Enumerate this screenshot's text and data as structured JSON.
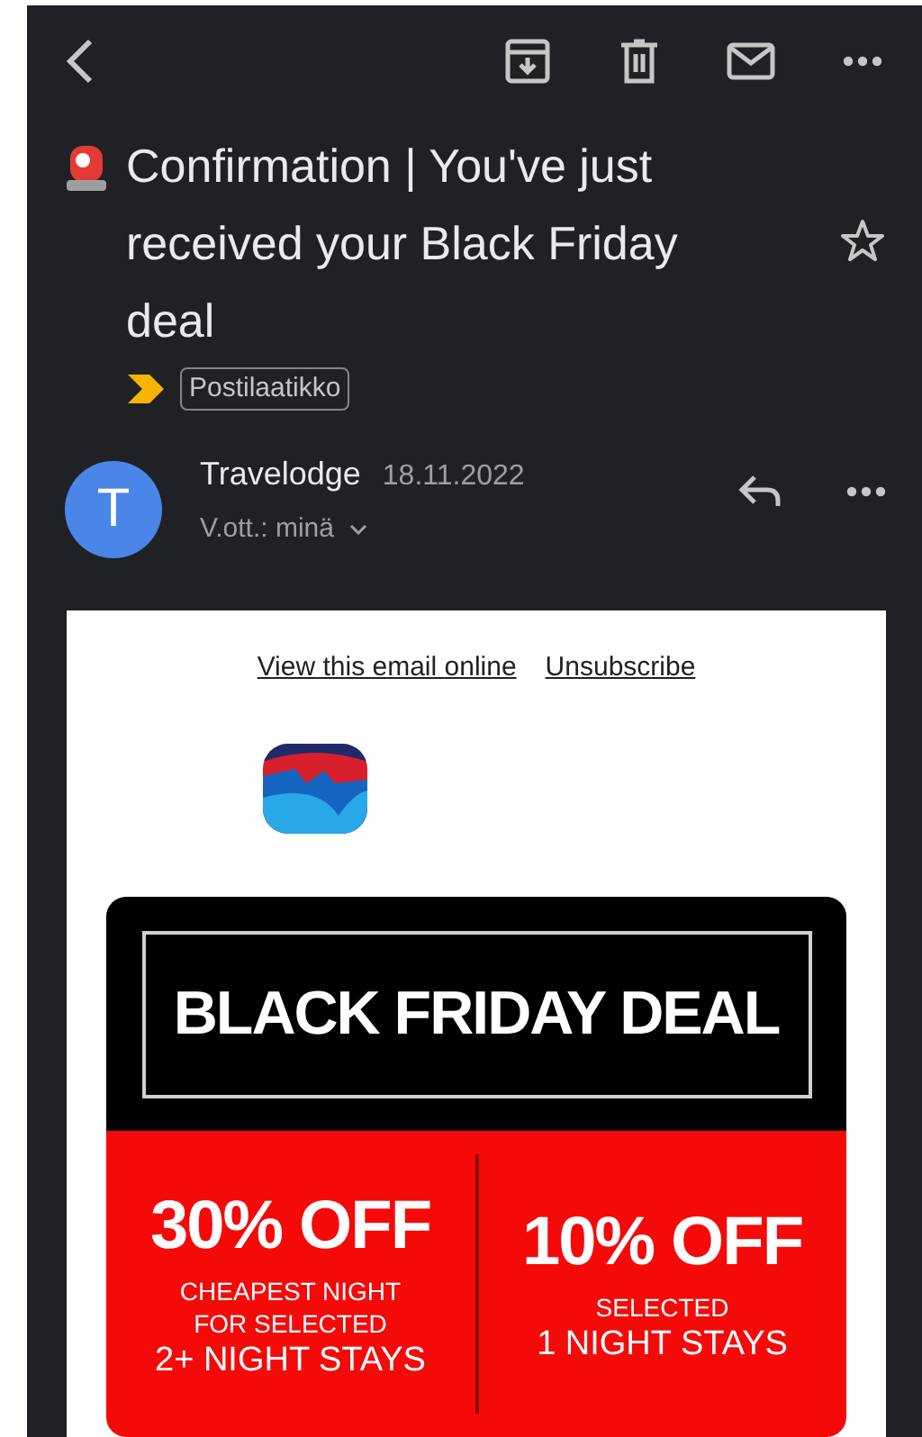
{
  "subject": "Confirmation | You've just received your Black Friday deal",
  "important": true,
  "label": "Postilaatikko",
  "starred": false,
  "sender": {
    "initial": "T",
    "name": "Travelodge",
    "date": "18.11.2022",
    "recipient": "V.ott.: minä"
  },
  "email": {
    "links": [
      "View this email online",
      "Unsubscribe"
    ],
    "banner": {
      "title": "BLACK FRIDAY DEAL",
      "offers": [
        {
          "headline": "30% OFF",
          "details": [
            "CHEAPEST NIGHT",
            "FOR SELECTED"
          ],
          "stay": "2+ NIGHT STAYS"
        },
        {
          "headline": "10% OFF",
          "details": [
            "SELECTED"
          ],
          "stay": "1 NIGHT STAYS"
        }
      ]
    }
  }
}
